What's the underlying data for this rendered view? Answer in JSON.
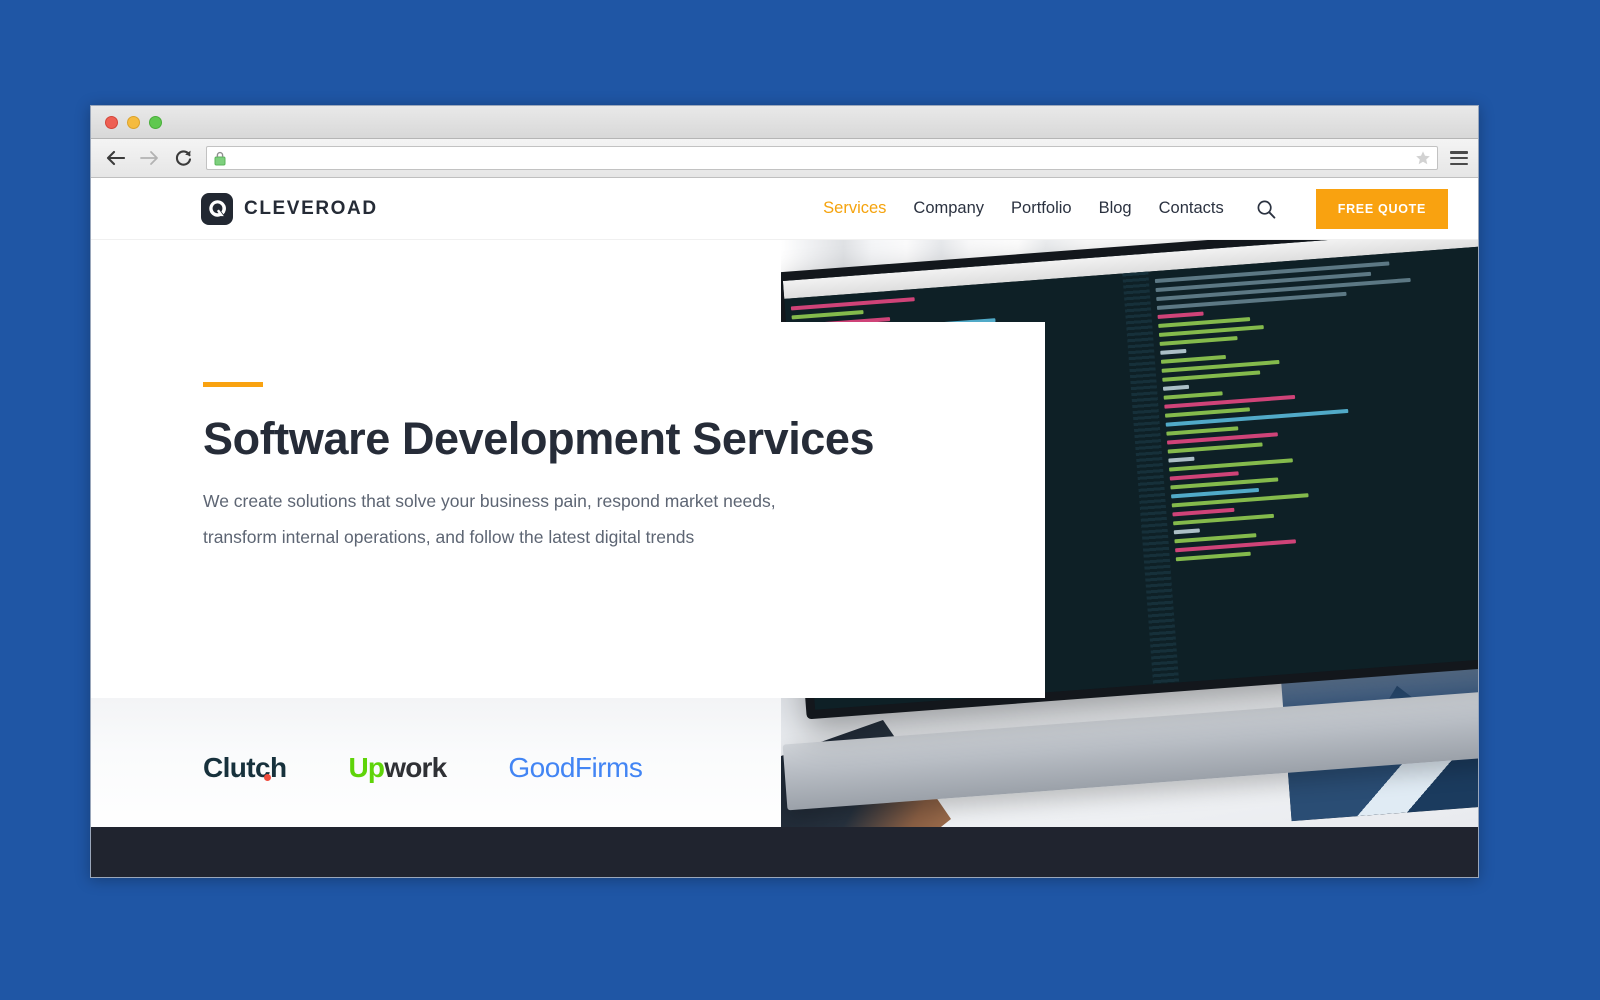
{
  "desktop": {
    "background_color": "#1f56a5"
  },
  "browser": {
    "traffic_lights": [
      "close",
      "minimize",
      "maximize"
    ],
    "back_icon": "back-arrow-icon",
    "forward_icon": "forward-arrow-icon",
    "reload_icon": "reload-icon",
    "lock_icon": "secure-lock-icon",
    "url_value": "",
    "url_placeholder": "",
    "bookmark_icon": "star-icon",
    "menu_icon": "hamburger-menu-icon"
  },
  "site": {
    "brand": {
      "mark_icon": "cleveroad-logo-icon",
      "name": "CLEVEROAD"
    },
    "nav": [
      {
        "label": "Services",
        "active": true
      },
      {
        "label": "Company",
        "active": false
      },
      {
        "label": "Portfolio",
        "active": false
      },
      {
        "label": "Blog",
        "active": false
      },
      {
        "label": "Contacts",
        "active": false
      }
    ],
    "search_icon": "search-icon",
    "cta": {
      "label": "FREE QUOTE",
      "color": "#f9a210"
    },
    "hero": {
      "accent_color": "#f9a210",
      "title": "Software Development Services",
      "subtitle_line1": "We create solutions that solve your business pain, respond market needs,",
      "subtitle_line2": "transform internal operations, and follow the latest digital trends"
    },
    "partners": [
      {
        "name": "Clutch",
        "color": "#17313c",
        "accent": "#ef4b3c"
      },
      {
        "name_part1": "Up",
        "name_part2": "work",
        "color1": "#5fd409",
        "color2": "#2f3135"
      },
      {
        "name": "GoodFirms",
        "color": "#4285f4"
      }
    ],
    "footer": {
      "color": "#20242f"
    }
  }
}
